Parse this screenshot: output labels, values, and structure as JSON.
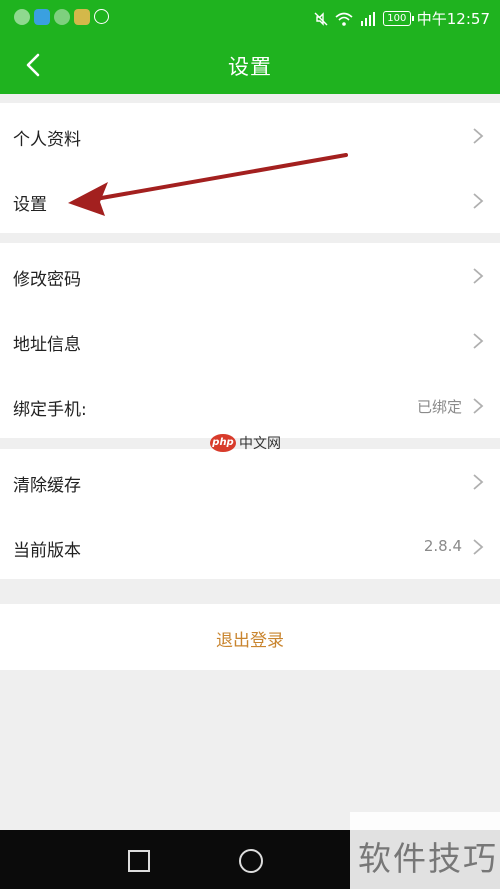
{
  "status_bar": {
    "battery": "100",
    "time": "中午12:57",
    "app_icon_colors": [
      "#8fd98f",
      "#3aa0e0",
      "#7ed07e",
      "#d4b84a",
      "#8fd98f"
    ]
  },
  "navbar": {
    "back_icon": "chevron-left-icon",
    "title": "设置"
  },
  "groups": [
    {
      "items": [
        {
          "label": "个人资料"
        },
        {
          "label": "设置"
        }
      ]
    },
    {
      "items": [
        {
          "label": "修改密码"
        },
        {
          "label": "地址信息"
        },
        {
          "label": "绑定手机:",
          "value": "已绑定"
        }
      ]
    },
    {
      "items": [
        {
          "label": "清除缓存"
        },
        {
          "label": "当前版本",
          "value": "2.8.4"
        }
      ]
    }
  ],
  "logout": {
    "label": "退出登录"
  },
  "watermarks": {
    "middle_badge": "php",
    "middle_text": "中文网",
    "corner_text": "软件技巧"
  },
  "colors": {
    "brand_green": "#1fb31f",
    "logout_orange": "#c9852f",
    "arrow_red": "#a3201f"
  }
}
